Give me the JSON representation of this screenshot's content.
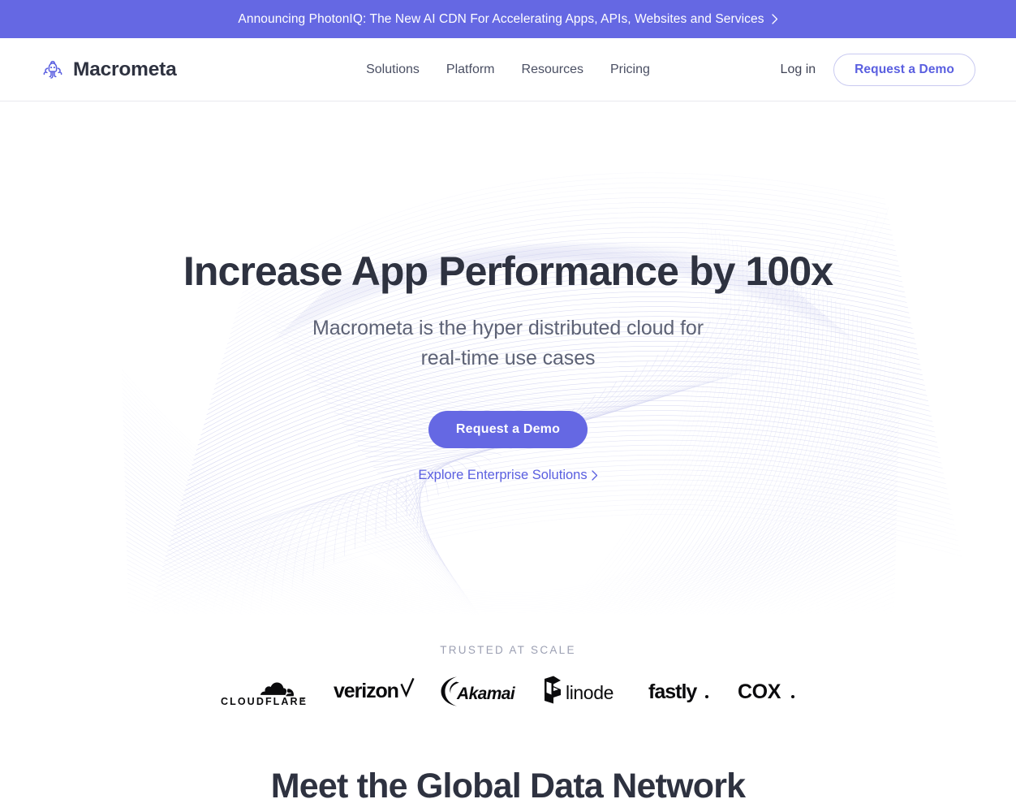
{
  "announcement": {
    "text": "Announcing PhotonIQ: The New AI CDN For Accelerating Apps, APIs, Websites and Services",
    "chevron_icon": "chevron-right-icon",
    "background_color": "#6568e3",
    "text_color": "#ffffff"
  },
  "header": {
    "brand": {
      "name": "Macrometa",
      "logo_icon": "macrometa-octopus-logo-icon",
      "logo_color": "#5a5fe0",
      "text_color": "#2e3240"
    },
    "nav": [
      {
        "label": "Solutions"
      },
      {
        "label": "Platform"
      },
      {
        "label": "Resources"
      },
      {
        "label": "Pricing"
      }
    ],
    "login_label": "Log in",
    "demo_label": "Request a Demo",
    "accent_color": "#5a5fe0"
  },
  "hero": {
    "title": "Increase App Performance by 100x",
    "subtitle_line1": "Macrometa is the hyper distributed cloud for",
    "subtitle_line2": "real-time use cases",
    "cta_label": "Request a Demo",
    "secondary_label": "Explore Enterprise Solutions",
    "secondary_chevron_icon": "chevron-right-icon",
    "cta_color": "#6568e3",
    "title_color": "#2e3240",
    "subtitle_color": "#5d6275",
    "art_name": "spirograph-wave-line-art",
    "art_color": "#b9bbe8"
  },
  "trusted": {
    "label": "TRUSTED AT SCALE",
    "logos": [
      {
        "name": "cloudflare",
        "label": "CLOUDFLARE",
        "icon": "cloudflare-logo-icon"
      },
      {
        "name": "verizon",
        "label": "verizon",
        "icon": "verizon-logo-icon"
      },
      {
        "name": "akamai",
        "label": "Akamai",
        "icon": "akamai-logo-icon"
      },
      {
        "name": "linode",
        "label": "linode",
        "icon": "linode-logo-icon"
      },
      {
        "name": "fastly",
        "label": "fastly",
        "icon": "fastly-logo-icon"
      },
      {
        "name": "cox",
        "label": "COX",
        "icon": "cox-logo-icon"
      }
    ]
  },
  "next_section": {
    "title": "Meet the Global Data Network"
  }
}
